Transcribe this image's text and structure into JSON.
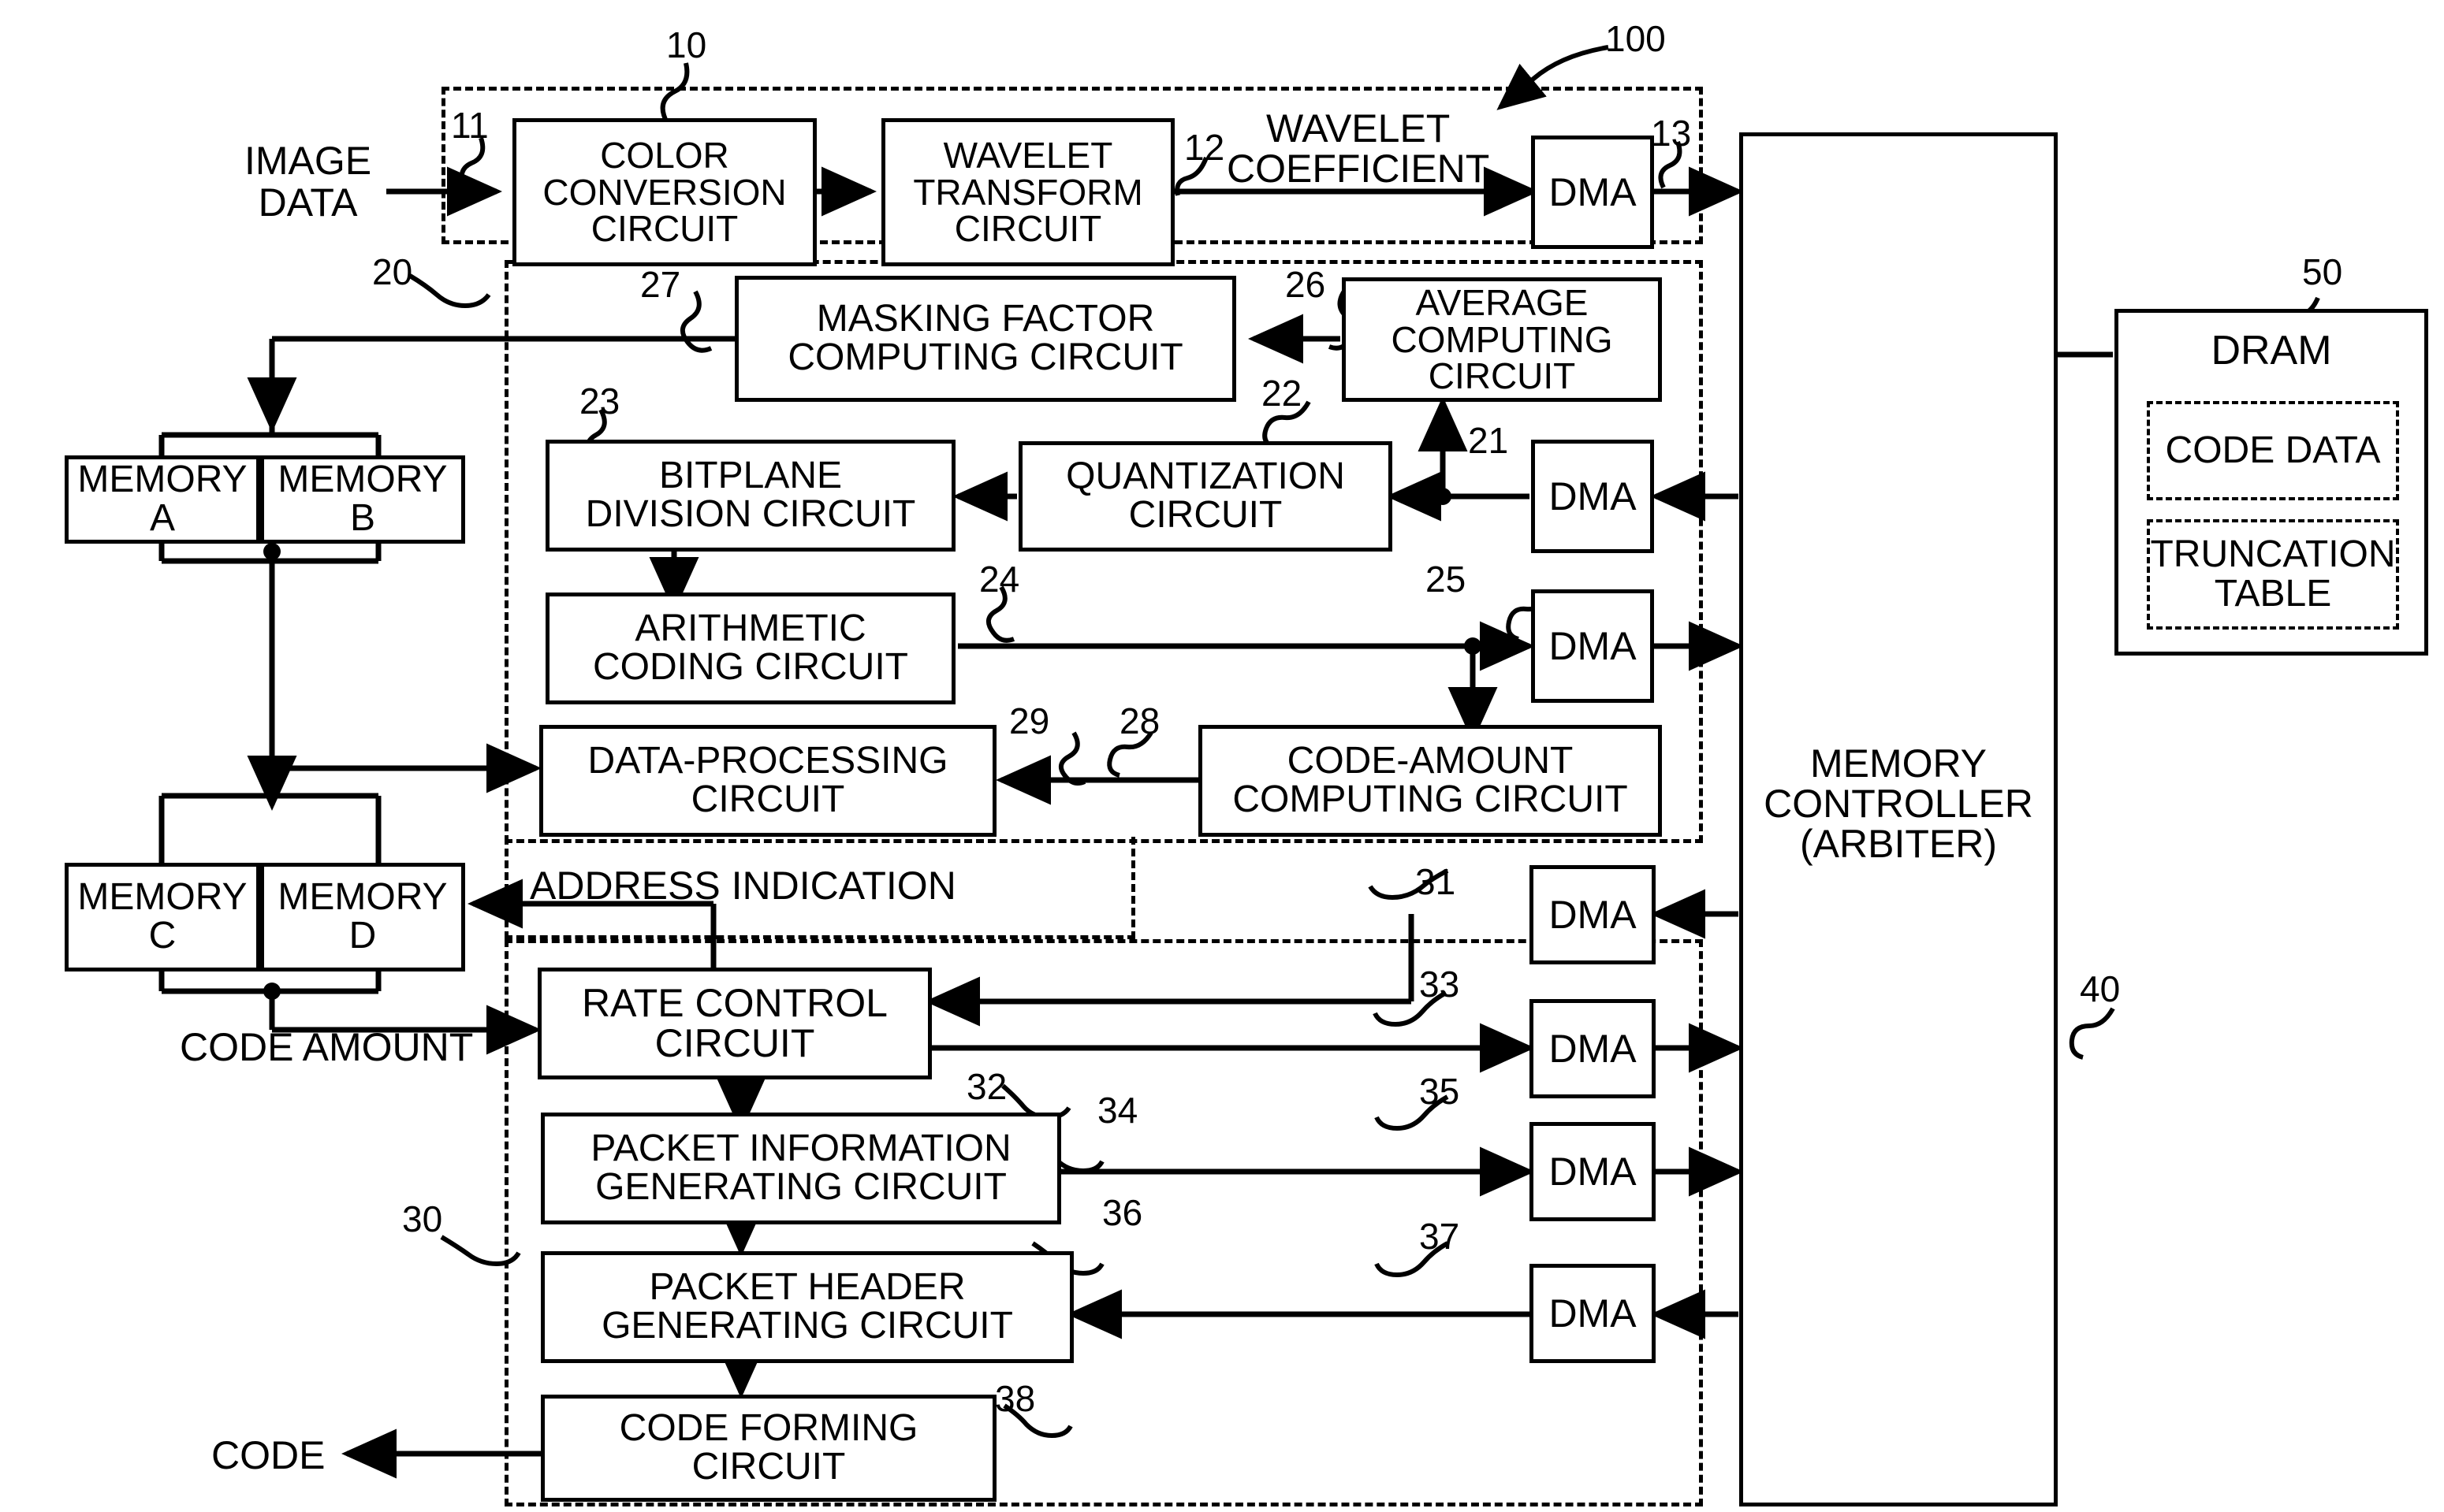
{
  "figure": {
    "type": "patent-block-diagram",
    "title_ref": "100"
  },
  "io_labels": {
    "image_data_line1": "IMAGE",
    "image_data_line2": "DATA",
    "wavelet_coefficient_line1": "WAVELET",
    "wavelet_coefficient_line2": "COEFFICIENT",
    "address_indication": "ADDRESS INDICATION",
    "code_amount": "CODE AMOUNT",
    "code_out": "CODE"
  },
  "refs": {
    "r10": "10",
    "r100": "100",
    "r11": "11",
    "r12": "12",
    "r13": "13",
    "r20": "20",
    "r21": "21",
    "r22": "22",
    "r23": "23",
    "r24": "24",
    "r25": "25",
    "r26": "26",
    "r27": "27",
    "r28": "28",
    "r29": "29",
    "r30": "30",
    "r31": "31",
    "r32": "32",
    "r33": "33",
    "r34": "34",
    "r35": "35",
    "r36": "36",
    "r37": "37",
    "r38": "38",
    "r40": "40",
    "r50": "50"
  },
  "blocks": {
    "color_conversion": {
      "line1": "COLOR",
      "line2": "CONVERSION",
      "line3": "CIRCUIT"
    },
    "wavelet_transform": {
      "line1": "WAVELET",
      "line2": "TRANSFORM",
      "line3": "CIRCUIT"
    },
    "dma_13": {
      "label": "DMA"
    },
    "masking_factor": {
      "line1": "MASKING FACTOR",
      "line2": "COMPUTING CIRCUIT"
    },
    "average_computing": {
      "line1": "AVERAGE",
      "line2": "COMPUTING",
      "line3": "CIRCUIT"
    },
    "bitplane_division": {
      "line1": "BITPLANE",
      "line2": "DIVISION CIRCUIT"
    },
    "quantization": {
      "line1": "QUANTIZATION",
      "line2": "CIRCUIT"
    },
    "dma_21": {
      "label": "DMA"
    },
    "arithmetic_coding": {
      "line1": "ARITHMETIC",
      "line2": "CODING CIRCUIT"
    },
    "dma_25": {
      "label": "DMA"
    },
    "data_processing": {
      "line1": "DATA-PROCESSING",
      "line2": "CIRCUIT"
    },
    "code_amount_computing": {
      "line1": "CODE-AMOUNT",
      "line2": "COMPUTING CIRCUIT"
    },
    "memory_a": {
      "line1": "MEMORY",
      "line2": "A"
    },
    "memory_b": {
      "line1": "MEMORY",
      "line2": "B"
    },
    "memory_c": {
      "line1": "MEMORY",
      "line2": "C"
    },
    "memory_d": {
      "line1": "MEMORY",
      "line2": "D"
    },
    "rate_control": {
      "line1": "RATE CONTROL",
      "line2": "CIRCUIT"
    },
    "packet_information": {
      "line1": "PACKET INFORMATION",
      "line2": "GENERATING CIRCUIT"
    },
    "packet_header": {
      "line1": "PACKET HEADER",
      "line2": "GENERATING CIRCUIT"
    },
    "code_forming": {
      "line1": "CODE FORMING",
      "line2": "CIRCUIT"
    },
    "dma_31": {
      "label": "DMA"
    },
    "dma_33": {
      "label": "DMA"
    },
    "dma_35": {
      "label": "DMA"
    },
    "dma_37": {
      "label": "DMA"
    },
    "memory_controller": {
      "line1": "MEMORY",
      "line2": "CONTROLLER",
      "line3": "(ARBITER)"
    },
    "dram": {
      "label": "DRAM"
    },
    "code_data": {
      "label": "CODE DATA"
    },
    "truncation_table": {
      "line1": "TRUNCATION",
      "line2": "TABLE"
    }
  },
  "colors": {
    "line": "#000000",
    "background": "#ffffff"
  }
}
